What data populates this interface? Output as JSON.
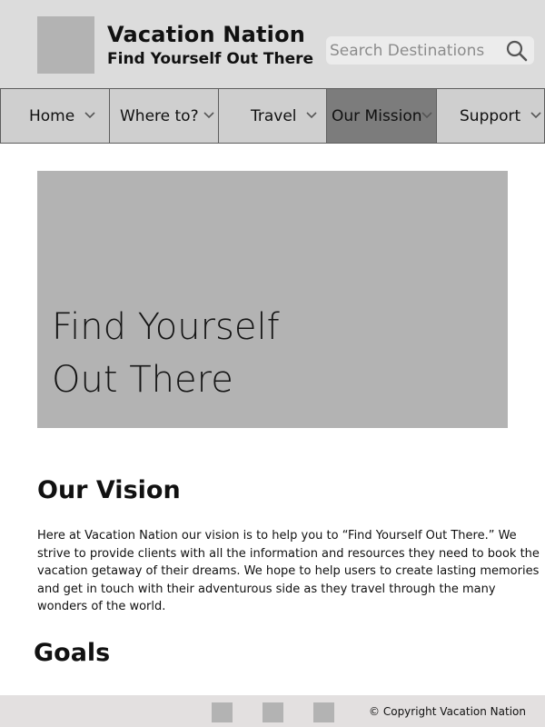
{
  "header": {
    "brand_title": "Vacation Nation",
    "tagline": "Find Yourself Out There",
    "logo_icon": "logo-placeholder",
    "search": {
      "placeholder": "Search Destinations",
      "value": "",
      "icon": "search-icon"
    }
  },
  "nav": {
    "items": [
      {
        "label": "Home",
        "active": false
      },
      {
        "label": "Where to?",
        "active": false
      },
      {
        "label": "Travel",
        "active": false
      },
      {
        "label": "Our Mission",
        "active": true
      },
      {
        "label": "Support",
        "active": false
      }
    ],
    "active_color": "#7c7c7c"
  },
  "hero": {
    "line1": "Find Yourself",
    "line2": "Out There"
  },
  "vision": {
    "title": "Our Vision",
    "body": "Here at Vacation Nation our vision is to help you to “Find Yourself Out There.” We strive to provide clients with all the information and resources they need to book the vacation getaway of their dreams. We hope to help users to create lasting memories and get in touch with their adventurous side as they travel through the many wonders of the world."
  },
  "goals": {
    "title": "Goals"
  },
  "footer": {
    "social_icons": [
      "social-icon-1",
      "social-icon-2",
      "social-icon-3"
    ],
    "copyright": "© Copyright Vacation Nation"
  }
}
